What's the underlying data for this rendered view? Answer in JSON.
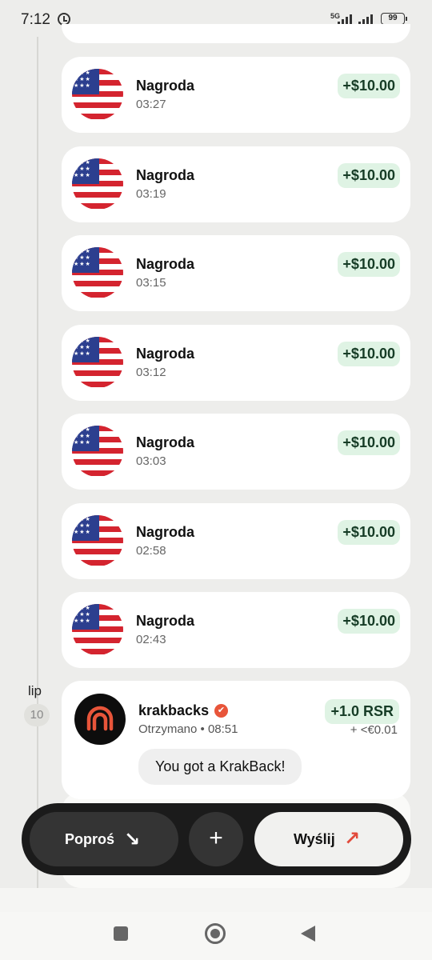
{
  "status_bar": {
    "time": "7:12",
    "network": "5G",
    "battery": "99"
  },
  "transactions": [
    {
      "title": "Nagroda",
      "time": "03:27",
      "amount": "+$10.00"
    },
    {
      "title": "Nagroda",
      "time": "03:19",
      "amount": "+$10.00"
    },
    {
      "title": "Nagroda",
      "time": "03:15",
      "amount": "+$10.00"
    },
    {
      "title": "Nagroda",
      "time": "03:12",
      "amount": "+$10.00"
    },
    {
      "title": "Nagroda",
      "time": "03:03",
      "amount": "+$10.00"
    },
    {
      "title": "Nagroda",
      "time": "02:58",
      "amount": "+$10.00"
    },
    {
      "title": "Nagroda",
      "time": "02:43",
      "amount": "+$10.00"
    }
  ],
  "date_group": {
    "month": "lip",
    "day": "10"
  },
  "krakback": {
    "name": "krakbacks",
    "subtitle": "Otrzymano • 08:51",
    "amount": "+1.0 RSR",
    "fiat": "+ <€0.01",
    "message": "You got a KrakBack!",
    "logo_color": "#e8553a"
  },
  "actions": {
    "request_label": "Poproś",
    "add_label": "+",
    "send_label": "Wyślij"
  },
  "colors": {
    "amount_bg": "#dff3e4",
    "accent": "#e24a3b"
  }
}
